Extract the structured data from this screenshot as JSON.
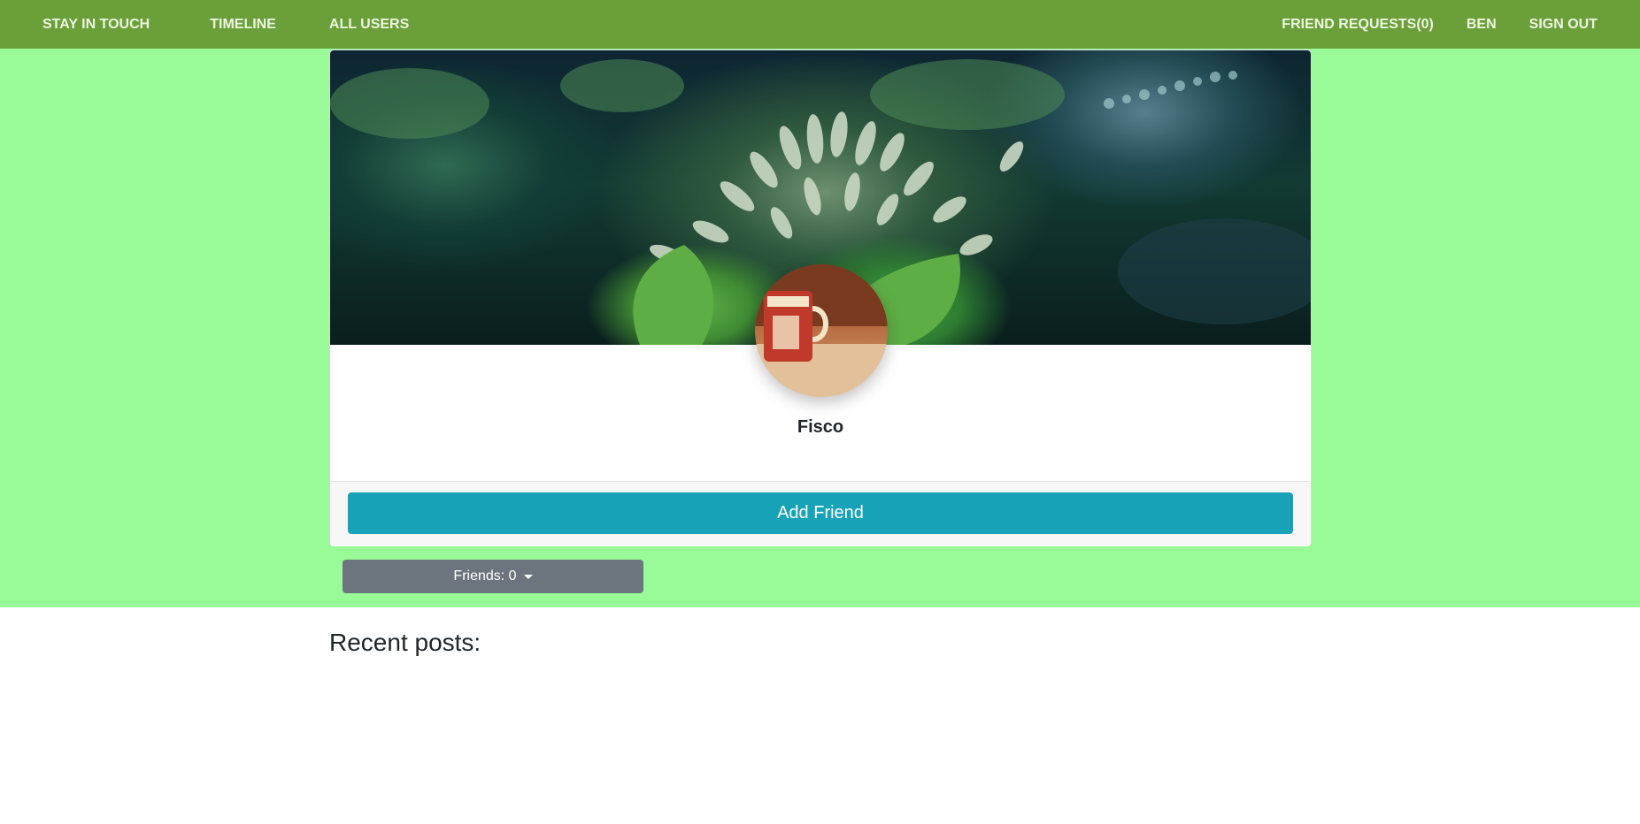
{
  "nav": {
    "left": [
      "STAY IN TOUCH",
      "TIMELINE",
      "ALL USERS"
    ],
    "right": [
      "FRIEND REQUESTS(0)",
      "BEN",
      "SIGN OUT"
    ]
  },
  "profile": {
    "name": "Fisco",
    "add_friend_label": "Add Friend",
    "friends_label": "Friends: 0"
  },
  "posts": {
    "heading": "Recent posts:"
  },
  "colors": {
    "navbar": "#6a9f3a",
    "hero_background": "#98fb98",
    "add_friend_button": "#17a2b8",
    "friends_button": "#6c757d"
  },
  "icons": {
    "friends_dropdown": "caret-down-icon"
  }
}
